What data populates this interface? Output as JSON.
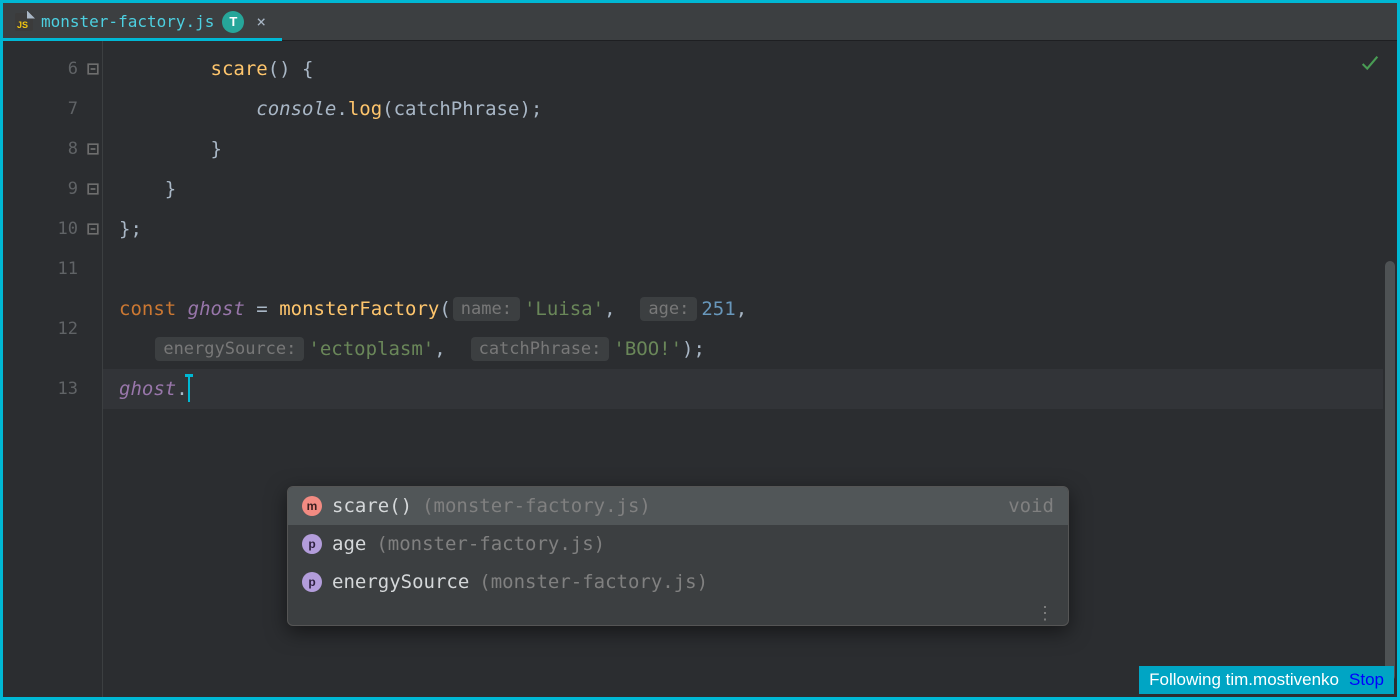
{
  "tab": {
    "filename": "monster-factory.js",
    "icon_label": "JS",
    "avatar_initial": "T",
    "close": "×"
  },
  "gutter": {
    "line_numbers": [
      "6",
      "7",
      "8",
      "9",
      "10",
      "11",
      "12",
      "13"
    ]
  },
  "code": {
    "l6": {
      "fn": "scare",
      "after": "() {"
    },
    "l7": {
      "obj": "console",
      "method": "log",
      "arg": "catchPhrase",
      "tail": ");"
    },
    "l8": {
      "brace": "}"
    },
    "l9": {
      "brace": "}"
    },
    "l10": {
      "text": "};"
    },
    "l12": {
      "kw": "const",
      "name": "ghost",
      "eq": " = ",
      "fn": "monsterFactory",
      "open": "(",
      "h1": "name:",
      "s1": "'Luisa'",
      "h2": "age:",
      "n2": "251",
      "h3": "energySource:",
      "s3": "'ectoplasm'",
      "h4": "catchPhrase:",
      "s4": "'BOO!'",
      "close": ");",
      "comma": ","
    },
    "l13": {
      "obj": "ghost",
      "dot": "."
    }
  },
  "completion": {
    "items": [
      {
        "kind": "m",
        "label": "scare()",
        "location": "(monster-factory.js)",
        "ret": "void"
      },
      {
        "kind": "p",
        "label": "age",
        "location": "(monster-factory.js)",
        "ret": ""
      },
      {
        "kind": "p",
        "label": "energySource",
        "location": "(monster-factory.js)",
        "ret": ""
      }
    ],
    "more": "⋮"
  },
  "status": {
    "text": "Following tim.mostivenko",
    "stop": "Stop"
  }
}
